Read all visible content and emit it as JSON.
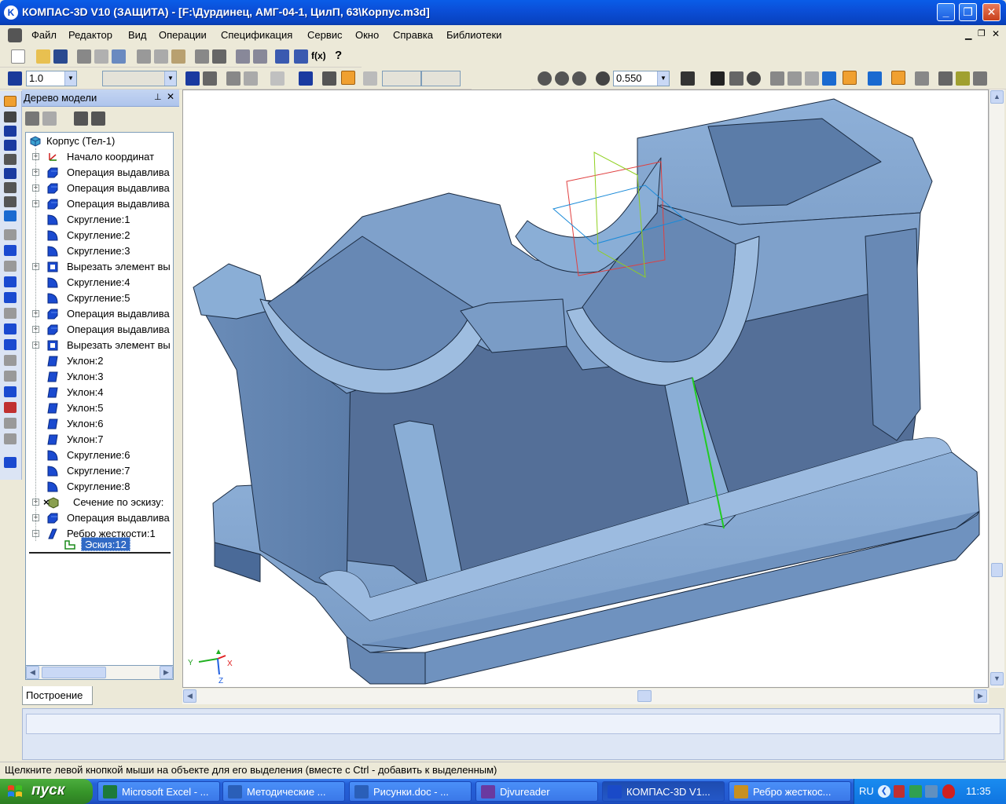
{
  "window": {
    "title": "КОМПАС-3D V10 (ЗАЩИТА) - [F:\\Дурдинец, АМГ-04-1, ЦилП, 63\\Корпус.m3d]",
    "app_icon": "K"
  },
  "menu": [
    "Файл",
    "Редактор",
    "Вид",
    "Операции",
    "Спецификация",
    "Сервис",
    "Окно",
    "Справка",
    "Библиотеки"
  ],
  "toolbar": {
    "step_value": "1.0",
    "zoom_value": "0.550",
    "fx_label": "f(x)"
  },
  "tree_panel": {
    "title": "Дерево модели",
    "pin": "ч",
    "root": "Корпус (Тел-1)",
    "items": [
      {
        "label": "Начало координат",
        "icon": "axis-icon",
        "expand": true
      },
      {
        "label": "Операция выдавлива",
        "icon": "extrude-icon",
        "expand": true
      },
      {
        "label": "Операция выдавлива",
        "icon": "extrude-icon",
        "expand": true
      },
      {
        "label": "Операция выдавлива",
        "icon": "extrude-icon",
        "expand": true
      },
      {
        "label": "Скругление:1",
        "icon": "fillet-icon",
        "expand": false
      },
      {
        "label": "Скругление:2",
        "icon": "fillet-icon",
        "expand": false
      },
      {
        "label": "Скругление:3",
        "icon": "fillet-icon",
        "expand": false
      },
      {
        "label": "Вырезать элемент вы",
        "icon": "cut-icon",
        "expand": true
      },
      {
        "label": "Скругление:4",
        "icon": "fillet-icon",
        "expand": false
      },
      {
        "label": "Скругление:5",
        "icon": "fillet-icon",
        "expand": false
      },
      {
        "label": "Операция выдавлива",
        "icon": "extrude-icon",
        "expand": true
      },
      {
        "label": "Операция выдавлива",
        "icon": "extrude-icon",
        "expand": true
      },
      {
        "label": "Вырезать элемент вы",
        "icon": "cut-icon",
        "expand": true
      },
      {
        "label": "Уклон:2",
        "icon": "draft-icon",
        "expand": false
      },
      {
        "label": "Уклон:3",
        "icon": "draft-icon",
        "expand": false
      },
      {
        "label": "Уклон:4",
        "icon": "draft-icon",
        "expand": false
      },
      {
        "label": "Уклон:5",
        "icon": "draft-icon",
        "expand": false
      },
      {
        "label": "Уклон:6",
        "icon": "draft-icon",
        "expand": false
      },
      {
        "label": "Уклон:7",
        "icon": "draft-icon",
        "expand": false
      },
      {
        "label": "Скругление:6",
        "icon": "fillet-icon",
        "expand": false
      },
      {
        "label": "Скругление:7",
        "icon": "fillet-icon",
        "expand": false
      },
      {
        "label": "Скругление:8",
        "icon": "fillet-icon",
        "expand": false
      },
      {
        "label": "Сечение по эскизу:",
        "icon": "section-icon",
        "expand": true
      },
      {
        "label": "Операция выдавлива",
        "icon": "extrude-icon",
        "expand": true
      },
      {
        "label": "Ребро жесткости:1",
        "icon": "rib-icon",
        "expand": true,
        "open": true
      }
    ],
    "selected_child": "Эскиз:12",
    "tab": "Построение"
  },
  "axes": {
    "x": "X",
    "y": "Y",
    "z": "Z"
  },
  "status": "Щелкните левой кнопкой мыши на объекте для его выделения (вместе с Ctrl - добавить к выделенным)",
  "taskbar": {
    "start": "пуск",
    "tasks": [
      {
        "label": "Microsoft Excel - ...",
        "icon": "excel-icon",
        "color": "#1d7a3a"
      },
      {
        "label": "Методические ...",
        "icon": "word-icon",
        "color": "#2a5fb8"
      },
      {
        "label": "Рисунки.doc - ...",
        "icon": "word-icon",
        "color": "#2a5fb8"
      },
      {
        "label": "Djvureader",
        "icon": "djvu-icon",
        "color": "#6a3aa0"
      },
      {
        "label": "КОМПАС-3D V1...",
        "icon": "kompas-icon",
        "color": "#1a4ac8",
        "active": true
      },
      {
        "label": "Ребро жесткос...",
        "icon": "rib-doc-icon",
        "color": "#c89020"
      }
    ],
    "lang": "RU",
    "clock": "11:35"
  },
  "colors": {
    "model": "#7a9cc6",
    "model_dark": "#5b7ca8",
    "titlebar": "#0b4fd8",
    "selection": "#316ac5"
  }
}
